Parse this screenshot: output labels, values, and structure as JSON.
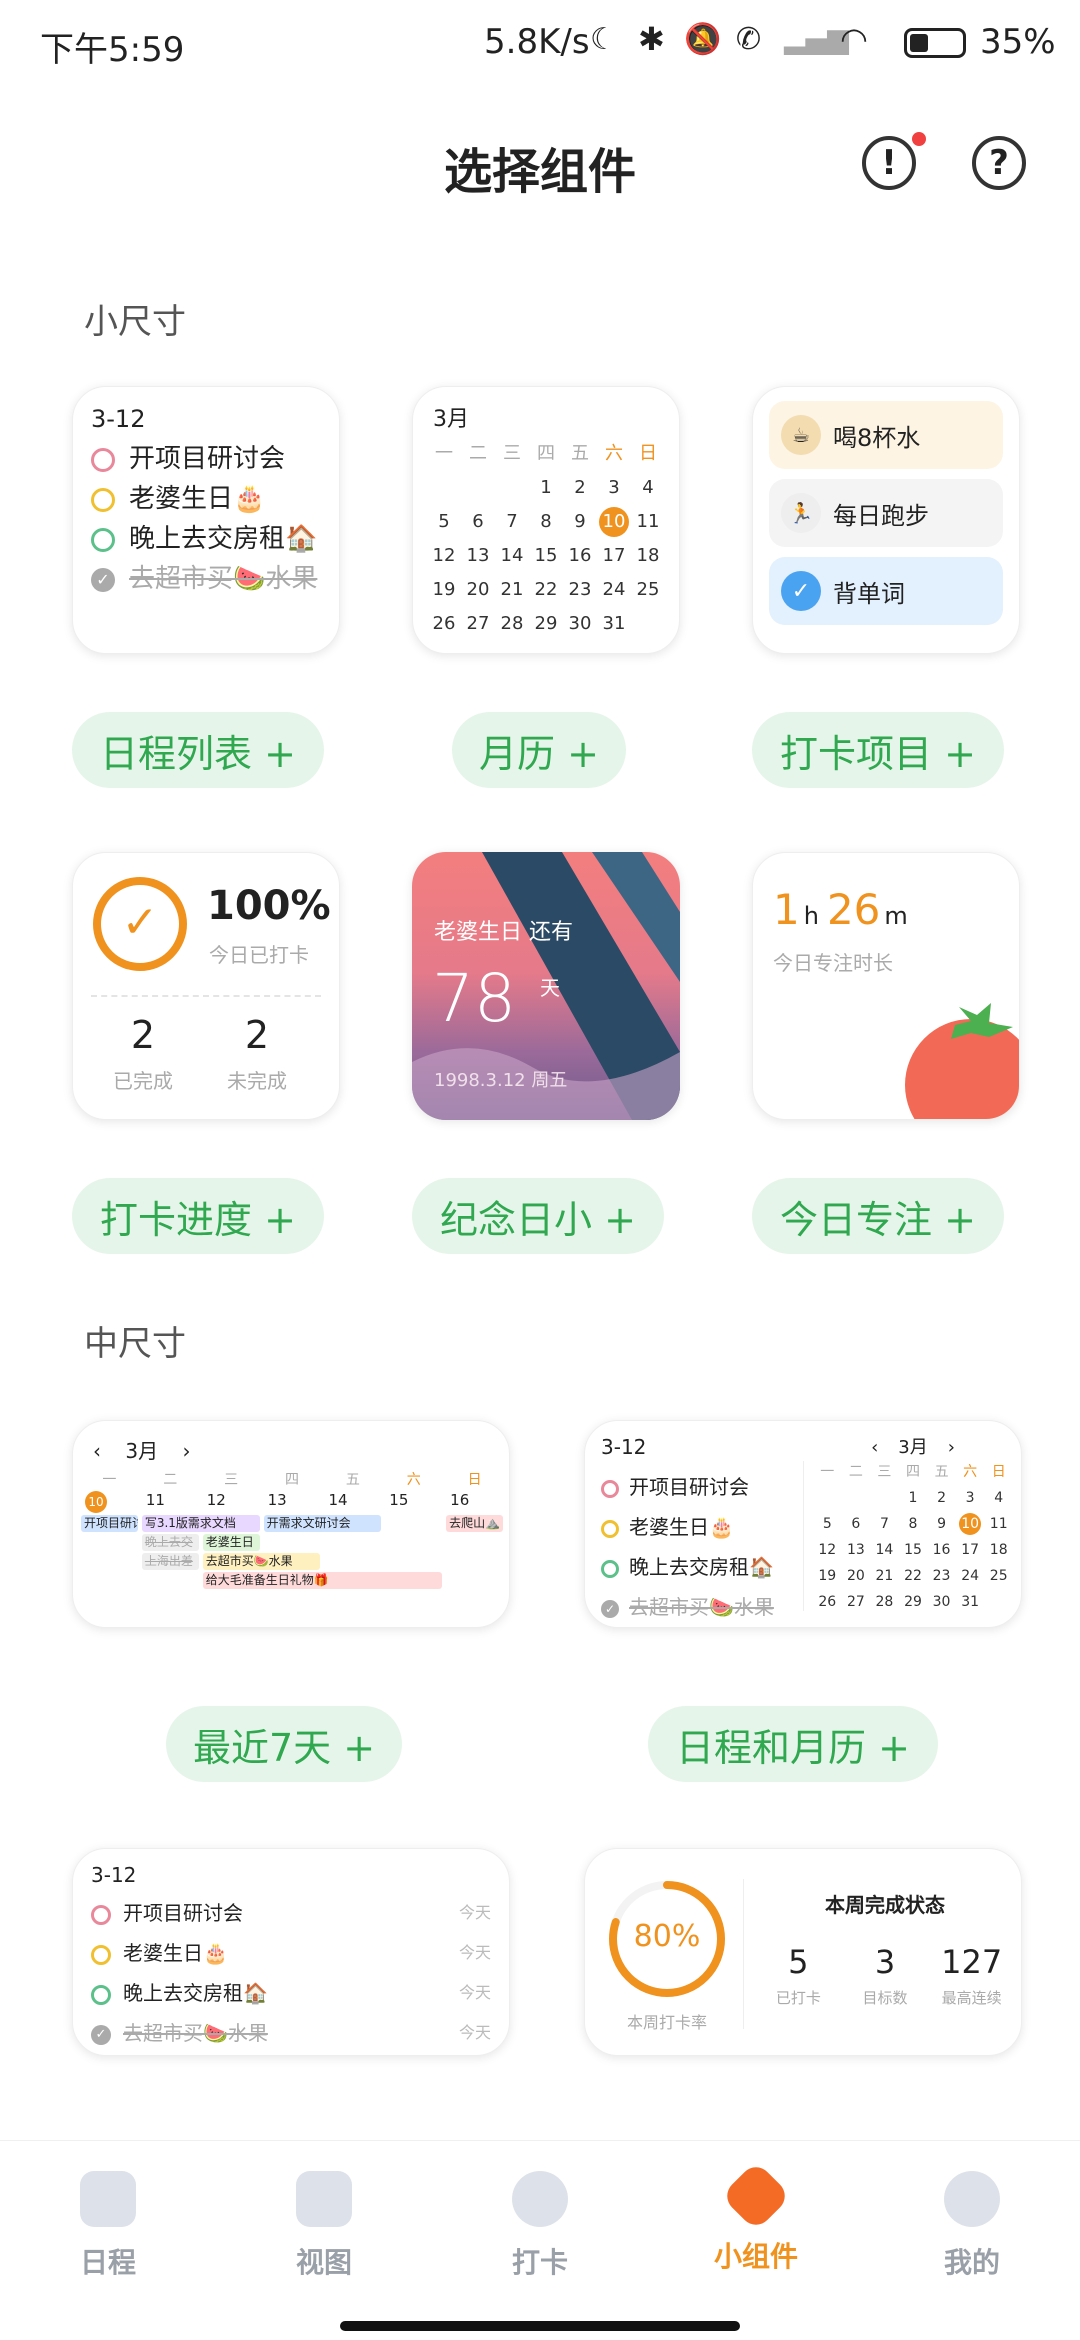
{
  "status": {
    "time": "下午5:59",
    "speed": "5.8K/s",
    "battery": "35%"
  },
  "header": {
    "title": "选择组件"
  },
  "sections": {
    "small": "小尺寸",
    "medium": "中尺寸"
  },
  "schedule_list": {
    "date": "3-12",
    "items": [
      {
        "label": "开项目研讨会",
        "color": "#e8889a",
        "done": false
      },
      {
        "label": "老婆生日🎂",
        "color": "#f0c030",
        "done": false
      },
      {
        "label": "晚上去交房租🏠",
        "color": "#5cc08a",
        "done": false
      },
      {
        "label": "去超市买🍉水果",
        "color": "#aaa",
        "done": true
      }
    ]
  },
  "month_cal": {
    "title": "3月",
    "weekdays": [
      "一",
      "二",
      "三",
      "四",
      "五",
      "六",
      "日"
    ],
    "days": [
      "",
      "",
      "",
      "1",
      "2",
      "3",
      "4",
      "5",
      "6",
      "7",
      "8",
      "9",
      "10",
      "11",
      "12",
      "13",
      "14",
      "15",
      "16",
      "17",
      "18",
      "19",
      "20",
      "21",
      "22",
      "23",
      "24",
      "25",
      "26",
      "27",
      "28",
      "29",
      "30",
      "31",
      ""
    ],
    "today": "10"
  },
  "checkin": {
    "items": [
      {
        "label": "喝8杯水",
        "icon": "☕"
      },
      {
        "label": "每日跑步",
        "icon": "🏃"
      },
      {
        "label": "背单词",
        "icon": "✓"
      }
    ]
  },
  "buttons": {
    "schedule_list": "日程列表 +",
    "month": "月历 +",
    "checkin": "打卡项目 +",
    "progress": "打卡进度 +",
    "anniversary": "纪念日小 +",
    "focus": "今日专注 +",
    "week7": "最近7天 +",
    "schedule_month": "日程和月历 +"
  },
  "progress": {
    "percent": "100%",
    "sub": "今日已打卡",
    "done": "2",
    "done_label": "已完成",
    "undone": "2",
    "undone_label": "未完成"
  },
  "anniversary": {
    "title": "老婆生日 还有",
    "days": "78",
    "unit": "天",
    "date": "1998.3.12  周五"
  },
  "focus": {
    "h": "1",
    "h_unit": "h",
    "m": "26",
    "m_unit": "m",
    "sub": "今日专注时长"
  },
  "week7": {
    "month": "3月",
    "weekdays": [
      "一",
      "二",
      "三",
      "四",
      "五",
      "六",
      "日"
    ],
    "dates": [
      "10",
      "11",
      "12",
      "13",
      "14",
      "15",
      "16"
    ],
    "events": [
      {
        "label": "开项目研讨",
        "color": "#cfe3ff"
      },
      {
        "label": "写3.1版需求文档",
        "color": "#e8d7ff"
      },
      {
        "label": "开需求文研讨会",
        "color": "#cfe3ff"
      },
      {
        "label": "去爬山⛰️",
        "color": "#ffdada"
      },
      {
        "label": "晚上去交",
        "color": "#eee"
      },
      {
        "label": "老婆生日",
        "color": "#dff5d8"
      },
      {
        "label": "去超市买🍉水果",
        "color": "#fff0c0"
      },
      {
        "label": "上海出差",
        "color": "#eee"
      },
      {
        "label": "给大毛准备生日礼物🎁",
        "color": "#ffdada"
      }
    ]
  },
  "sched_month": {
    "date": "3-12",
    "month": "3月"
  },
  "list_today": {
    "date": "3-12",
    "tag": "今天"
  },
  "weekly": {
    "title": "本周完成状态",
    "rate": "80%",
    "rate_label": "本周打卡率",
    "stats": [
      {
        "value": "5",
        "label": "已打卡"
      },
      {
        "value": "3",
        "label": "目标数"
      },
      {
        "value": "127",
        "label": "最高连续"
      }
    ]
  },
  "nav": {
    "items": [
      "日程",
      "视图",
      "打卡",
      "小组件",
      "我的"
    ],
    "active": 3
  }
}
